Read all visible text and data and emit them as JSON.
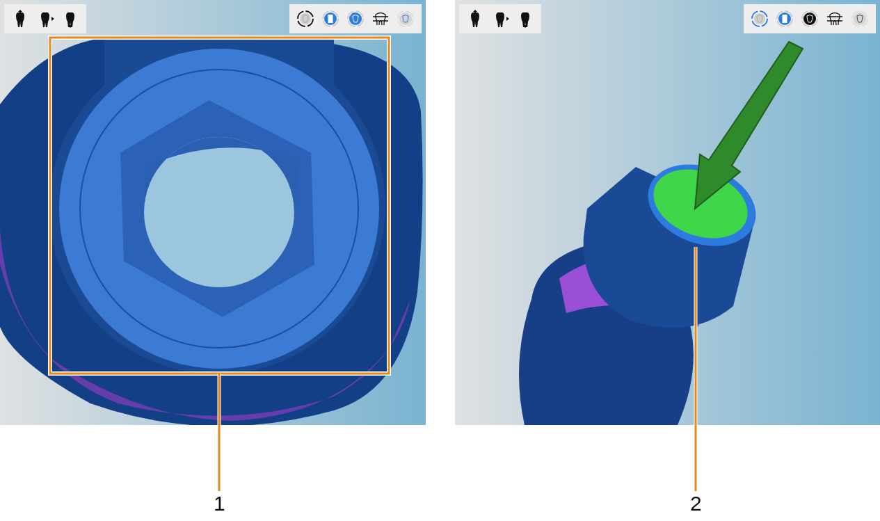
{
  "panels": [
    {
      "kind": "top-view",
      "callout": "1"
    },
    {
      "kind": "side-view",
      "callout": "2"
    }
  ]
}
